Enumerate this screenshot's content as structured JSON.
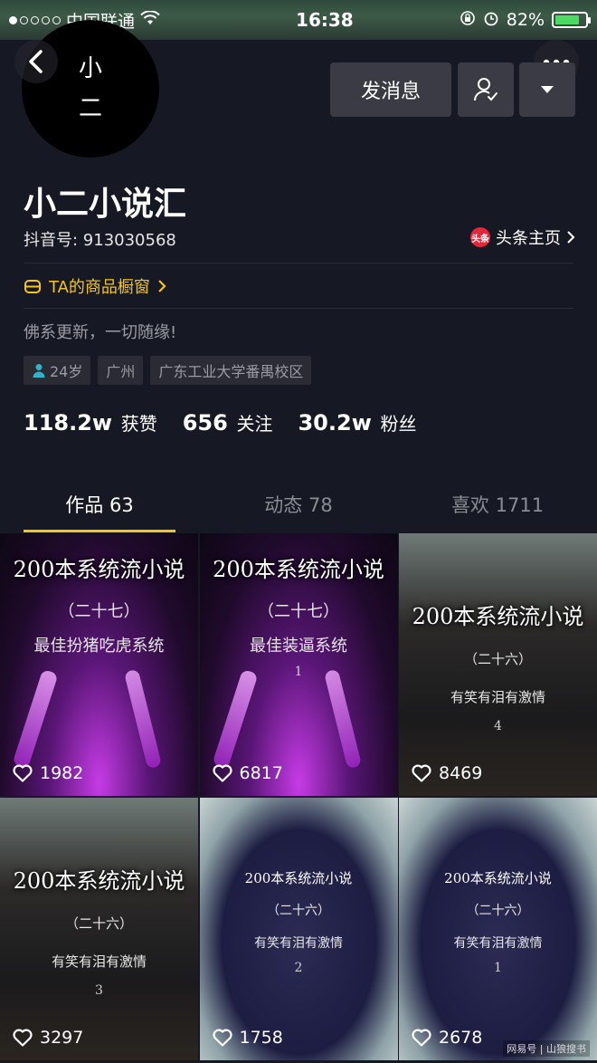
{
  "status_bar": {
    "carrier": "中国联通",
    "time": "16:38",
    "battery": "82%",
    "battery_level": 0.82
  },
  "profile": {
    "avatar_text_1": "小",
    "avatar_text_2": "二",
    "name": "小二小说汇",
    "douyin_id": "抖音号: 913030568",
    "toutiao_badge": "头条",
    "toutiao_label": "头条主页",
    "shop_label": "TA的商品橱窗",
    "bio": "佛系更新，一切随缘!",
    "tags": {
      "age": "24岁",
      "city": "广州",
      "school": "广东工业大学番禺校区"
    }
  },
  "actions": {
    "message_label": "发消息"
  },
  "stats": {
    "likes_num": "118.2w",
    "likes_label": "获赞",
    "following_num": "656",
    "following_label": "关注",
    "fans_num": "30.2w",
    "fans_label": "粉丝"
  },
  "tabs": [
    {
      "label": "作品 63"
    },
    {
      "label": "动态 78"
    },
    {
      "label": "喜欢 1711"
    }
  ],
  "videos": [
    {
      "title": "200本系统流小说",
      "sub": "（二十七）",
      "line": "最佳扮猪吃虎系统",
      "num": "",
      "likes": "1982"
    },
    {
      "title": "200本系统流小说",
      "sub": "（二十七）",
      "line": "最佳装逼系统",
      "num": "1",
      "likes": "6817"
    },
    {
      "title": "200本系统流小说",
      "sub": "（二十六）",
      "line": "有笑有泪有激情",
      "num": "4",
      "likes": "8469"
    },
    {
      "title": "200本系统流小说",
      "sub": "（二十六）",
      "line": "有笑有泪有激情",
      "num": "3",
      "likes": "3297"
    },
    {
      "title": "200本系统流小说",
      "sub": "（二十六）",
      "line": "有笑有泪有激情",
      "num": "2",
      "likes": "1758"
    },
    {
      "title": "200本系统流小说",
      "sub": "（二十六）",
      "line": "有笑有泪有激情",
      "num": "1",
      "likes": "2678"
    }
  ],
  "watermark": "网易号 | 山狼搜书",
  "colors": {
    "background": "#161823",
    "accent": "#f5c518",
    "button": "#3a3b44"
  }
}
